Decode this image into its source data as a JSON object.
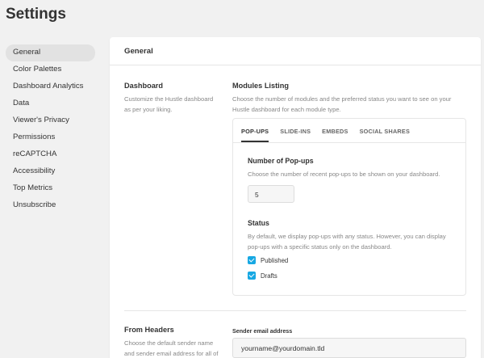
{
  "page_title": "Settings",
  "sidebar": {
    "items": [
      {
        "label": "General"
      },
      {
        "label": "Color Palettes"
      },
      {
        "label": "Dashboard Analytics"
      },
      {
        "label": "Data"
      },
      {
        "label": "Viewer's Privacy"
      },
      {
        "label": "Permissions"
      },
      {
        "label": "reCAPTCHA"
      },
      {
        "label": "Accessibility"
      },
      {
        "label": "Top Metrics"
      },
      {
        "label": "Unsubscribe"
      }
    ],
    "active_index": 0
  },
  "panel": {
    "title": "General",
    "dashboard": {
      "title": "Dashboard",
      "description": "Customize the Hustle dashboard as per your liking."
    },
    "modules_listing": {
      "title": "Modules Listing",
      "description": "Choose the number of modules and the preferred status you want to see on your Hustle dashboard for each module type.",
      "tabs": [
        "POP-UPS",
        "SLIDE-INS",
        "EMBEDS",
        "SOCIAL SHARES"
      ],
      "active_tab": 0,
      "number_title": "Number of Pop-ups",
      "number_description": "Choose the number of recent pop-ups to be shown on your dashboard.",
      "number_value": "5",
      "status_title": "Status",
      "status_description": "By default, we display pop-ups with any status. However, you can display pop-ups with a specific status only on the dashboard.",
      "checkboxes": [
        {
          "label": "Published",
          "checked": true
        },
        {
          "label": "Drafts",
          "checked": true
        }
      ]
    },
    "from_headers": {
      "title": "From Headers",
      "description": "Choose the default sender name and sender email address for all of",
      "email_label": "Sender email address",
      "email_value": "yourname@yourdomain.tld"
    }
  },
  "colors": {
    "accent": "#17a8e3",
    "background": "#f1f1f1",
    "panel": "#ffffff"
  }
}
